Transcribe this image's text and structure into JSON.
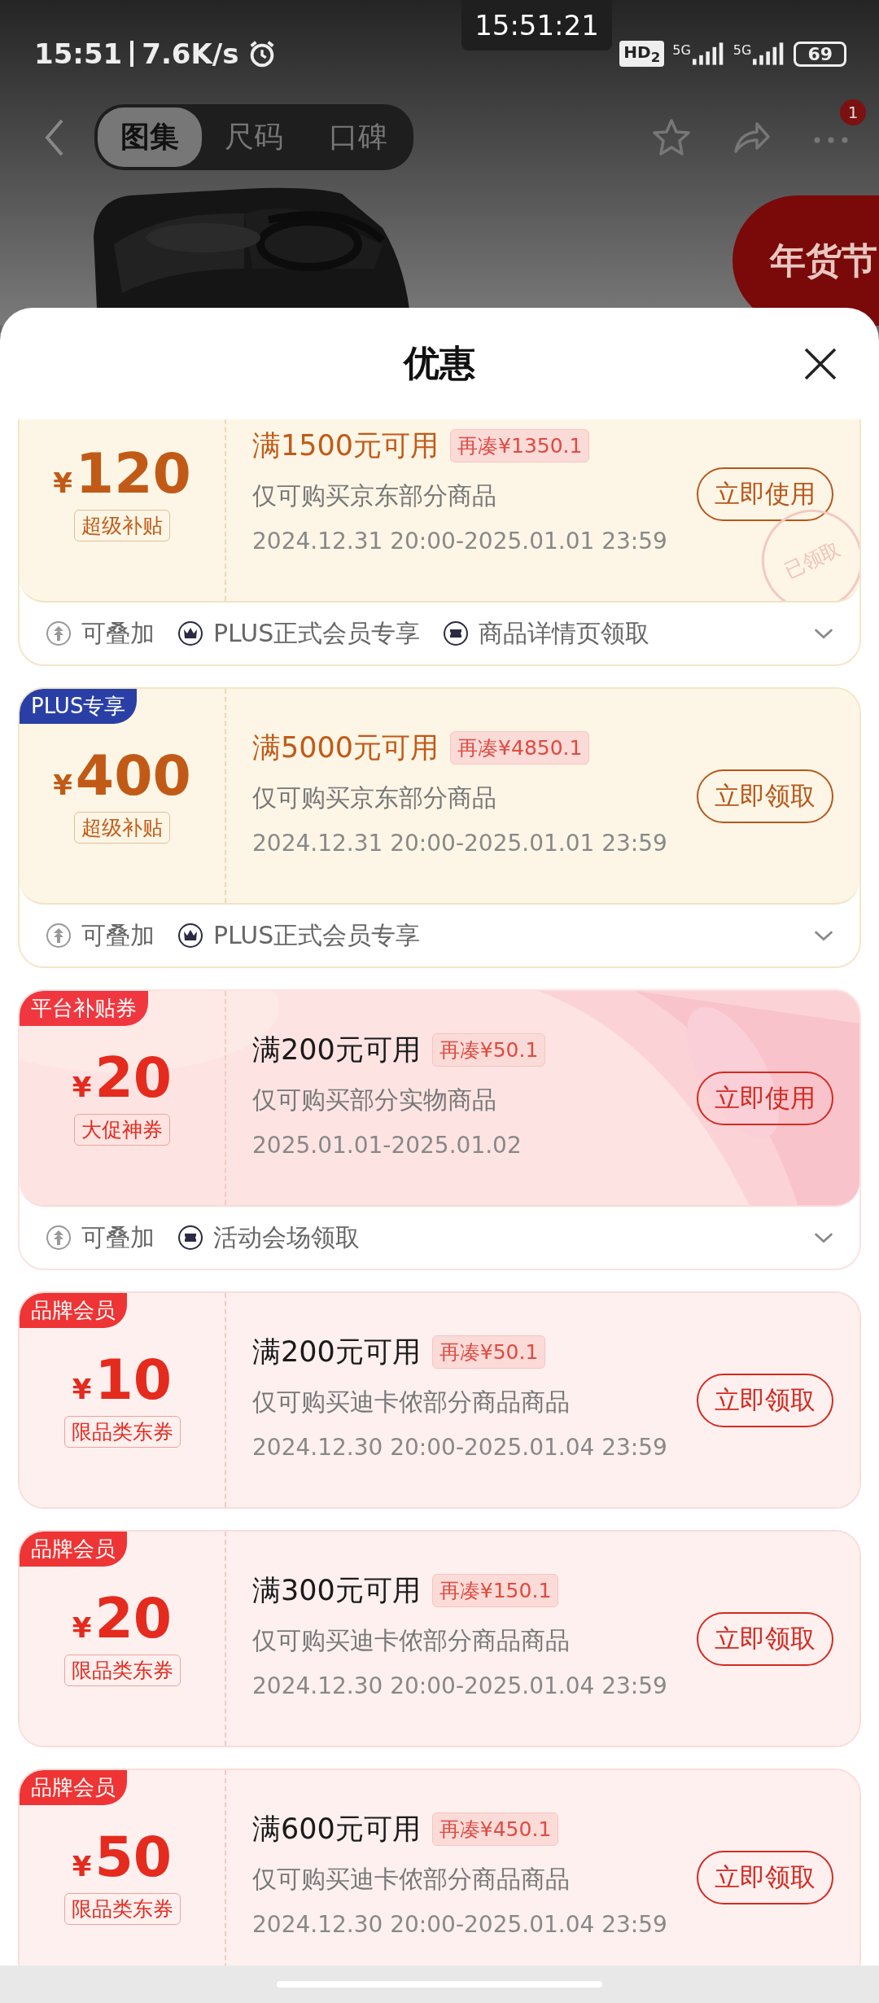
{
  "status_bar": {
    "time": "15:51",
    "speed": "7.6K/s",
    "clock_overlay": "15:51:21",
    "hd": "HD$_{2}$",
    "network_1": "5G",
    "network_2": "5G",
    "battery": "69"
  },
  "nav": {
    "tabs": [
      {
        "label": "图集",
        "selected": true
      },
      {
        "label": "尺码",
        "selected": false
      },
      {
        "label": "口碑",
        "selected": false
      }
    ],
    "more_badge": "1",
    "promo_badge": "年货节"
  },
  "sheet": {
    "title": "优惠"
  },
  "coupons": [
    {
      "kind": "gold",
      "currency": "¥",
      "amount": "120",
      "type_tag": "超级补贴",
      "threshold": "满1500元可用",
      "gap_tag": "再凑¥1350.1",
      "scope": "仅可购买京东部分商品",
      "validity": "2024.12.31 20:00-2025.01.01 23:59",
      "button": "立即使用",
      "stamp": "已领取",
      "features": [
        {
          "kind": "stack",
          "label": "可叠加"
        },
        {
          "kind": "crown",
          "label": "PLUS正式会员专享"
        },
        {
          "kind": "ticket",
          "label": "商品详情页领取"
        }
      ]
    },
    {
      "kind": "gold",
      "corner_tag": {
        "label": "PLUS专享",
        "color": "#2a3fa6"
      },
      "currency": "¥",
      "amount": "400",
      "type_tag": "超级补贴",
      "threshold": "满5000元可用",
      "gap_tag": "再凑¥4850.1",
      "scope": "仅可购买京东部分商品",
      "validity": "2024.12.31 20:00-2025.01.01 23:59",
      "button": "立即领取",
      "features": [
        {
          "kind": "stack",
          "label": "可叠加"
        },
        {
          "kind": "crown",
          "label": "PLUS正式会员专享"
        }
      ]
    },
    {
      "kind": "pink",
      "corner_tag": {
        "label": "平台补贴券",
        "color": "#f0373f"
      },
      "currency": "¥",
      "amount": "20",
      "type_tag": "大促神券",
      "threshold": "满200元可用",
      "gap_tag": "再凑¥50.1",
      "scope": "仅可购买部分实物商品",
      "validity": "2025.01.01-2025.01.02",
      "button": "立即使用",
      "features": [
        {
          "kind": "stack",
          "label": "可叠加"
        },
        {
          "kind": "ticket",
          "label": "活动会场领取"
        }
      ]
    },
    {
      "kind": "red",
      "corner_tag": {
        "label": "品牌会员",
        "color": "#ee3434"
      },
      "currency": "¥",
      "amount": "10",
      "type_tag": "限品类东券",
      "threshold": "满200元可用",
      "gap_tag": "再凑¥50.1",
      "scope": "仅可购买迪卡侬部分商品商品",
      "validity": "2024.12.30 20:00-2025.01.04 23:59",
      "button": "立即领取"
    },
    {
      "kind": "red",
      "corner_tag": {
        "label": "品牌会员",
        "color": "#ee3434"
      },
      "currency": "¥",
      "amount": "20",
      "type_tag": "限品类东券",
      "threshold": "满300元可用",
      "gap_tag": "再凑¥150.1",
      "scope": "仅可购买迪卡侬部分商品商品",
      "validity": "2024.12.30 20:00-2025.01.04 23:59",
      "button": "立即领取"
    },
    {
      "kind": "red",
      "corner_tag": {
        "label": "品牌会员",
        "color": "#ee3434"
      },
      "currency": "¥",
      "amount": "50",
      "type_tag": "限品类东券",
      "threshold": "满600元可用",
      "gap_tag": "再凑¥450.1",
      "scope": "仅可购买迪卡侬部分商品商品",
      "validity": "2024.12.30 20:00-2025.01.04 23:59",
      "button": "立即领取"
    }
  ]
}
